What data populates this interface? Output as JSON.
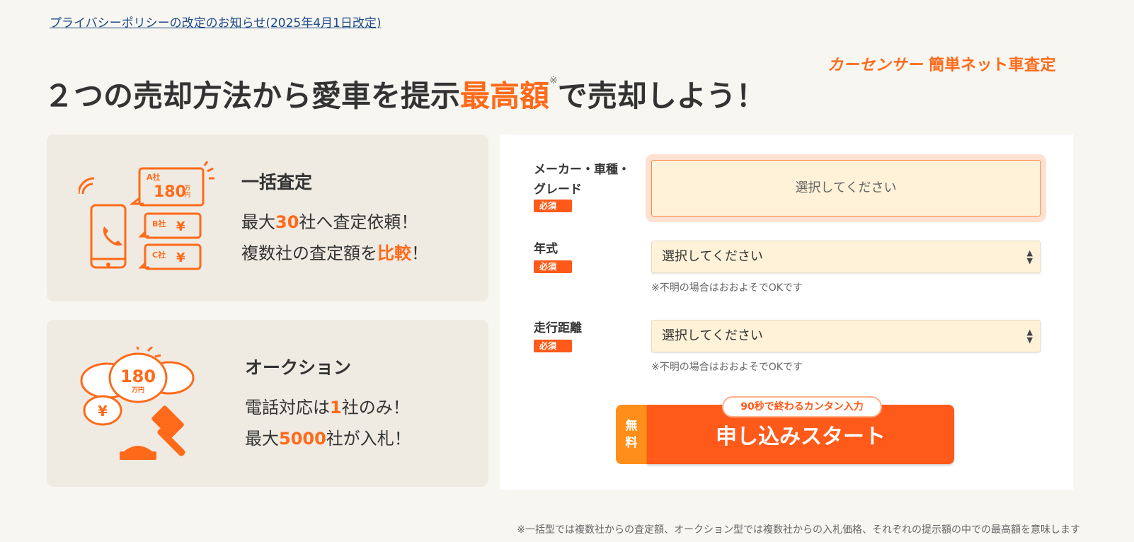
{
  "privacy_link": "プライバシーポリシーの改定のお知らせ(2025年4月1日改定)",
  "brand": {
    "logo": "カーセンサー",
    "name": "簡単ネット車査定"
  },
  "headline": {
    "pre": "２つの売却方法から愛車を提示",
    "accent": "最高額",
    "mark": "※",
    "post": "で売却しよう！"
  },
  "card1": {
    "title": "一括査定",
    "line1": {
      "a": "最大",
      "num": "30",
      "b": "社へ査定依頼！"
    },
    "line2": {
      "a": "複数社の査定額を",
      "num": "比較",
      "b": "！"
    },
    "icon": {
      "a_label": "A社",
      "a_value": "180",
      "a_unit1": "万",
      "a_unit2": "円",
      "b_label": "B社",
      "c_label": "C社",
      "yen": "¥"
    }
  },
  "card2": {
    "title": "オークション",
    "line1": {
      "a": "電話対応は",
      "num": "1",
      "b": "社のみ！"
    },
    "line2": {
      "a": "最大",
      "num": "5000",
      "b": "社が入札！"
    },
    "icon": {
      "value": "180",
      "unit": "万円",
      "yen": "¥"
    }
  },
  "form": {
    "maker": {
      "label": "メーカー・車種・グレード",
      "required": "必須",
      "placeholder": "選択してください"
    },
    "year": {
      "label": "年式",
      "required": "必須",
      "value": "選択してください",
      "hint": "※不明の場合はおおよそでOKです"
    },
    "mileage": {
      "label": "走行距離",
      "required": "必須",
      "value": "選択してください",
      "hint": "※不明の場合はおおよそでOKです"
    },
    "cta": {
      "free1": "無",
      "free2": "料",
      "bubble": "90秒で終わるカンタン入力",
      "label": "申し込みスタート"
    }
  },
  "footnote": "※一括型では複数社からの査定額、オークション型では複数社からの入札価格、それぞれの提示額の中での最高額を意味します",
  "colors": {
    "accent": "#ff6a1a",
    "cta": "#ff5a1a",
    "free": "#ff8f1a",
    "field": "#fff2d8"
  }
}
